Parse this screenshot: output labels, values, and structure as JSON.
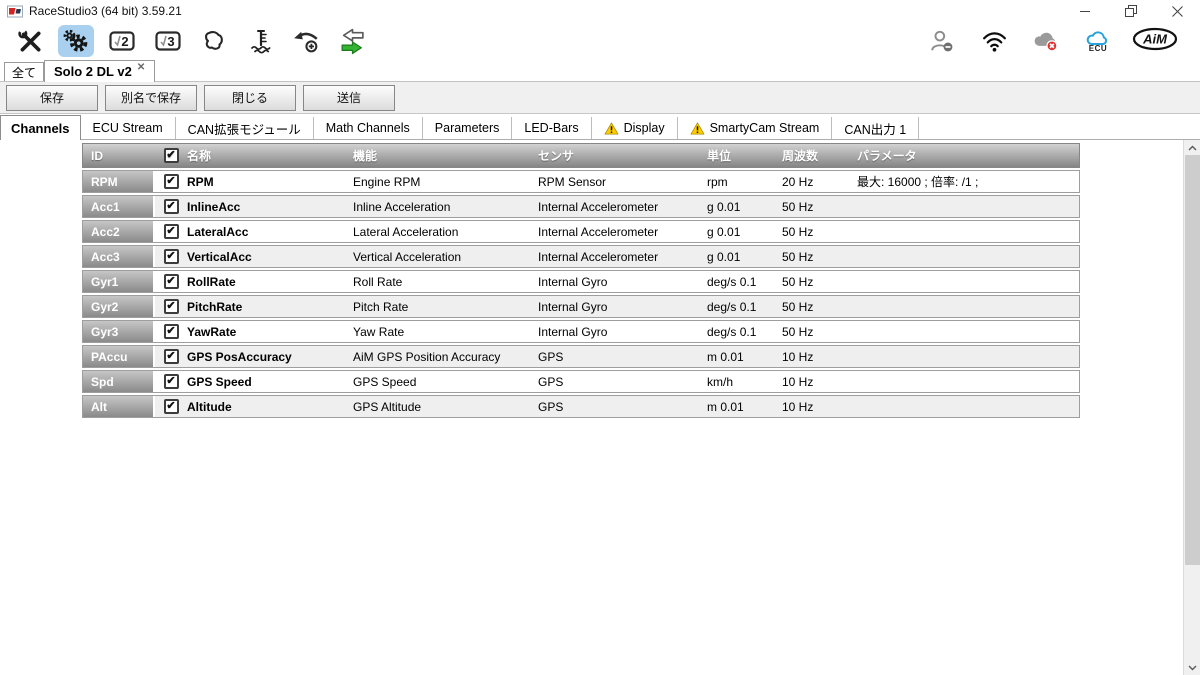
{
  "window": {
    "title": "RaceStudio3 (64 bit) 3.59.21"
  },
  "toolbar": {
    "left_icons": [
      {
        "name": "tools-wrench-icon",
        "active": false
      },
      {
        "name": "device-config-gear-icon",
        "active": true
      },
      {
        "name": "analysis-rs2-icon",
        "active": false,
        "glyph": "2"
      },
      {
        "name": "analysis-rs3-icon",
        "active": false,
        "glyph": "3"
      },
      {
        "name": "track-manager-icon",
        "active": false
      },
      {
        "name": "fuel-level-icon",
        "active": false
      },
      {
        "name": "add-device-icon",
        "active": false
      },
      {
        "name": "data-download-icon",
        "active": false
      }
    ],
    "right_icons": [
      {
        "name": "account-icon"
      },
      {
        "name": "wifi-icon"
      },
      {
        "name": "cloud-offline-icon"
      },
      {
        "name": "cloud-ecu-icon",
        "label": "ECU"
      },
      {
        "name": "aim-logo",
        "label": "AiM"
      }
    ]
  },
  "config_tabs": [
    {
      "label": "全て",
      "active": false,
      "closable": false
    },
    {
      "label": "Solo 2 DL v2",
      "active": true,
      "closable": true
    }
  ],
  "action_buttons": [
    {
      "label": "保存"
    },
    {
      "label": "別名で保存"
    },
    {
      "label": "閉じる"
    },
    {
      "label": "送信"
    }
  ],
  "device_tabs": [
    {
      "label": "Channels",
      "active": true,
      "warning": false
    },
    {
      "label": "ECU Stream",
      "active": false,
      "warning": false
    },
    {
      "label": "CAN拡張モジュール",
      "active": false,
      "warning": false
    },
    {
      "label": "Math Channels",
      "active": false,
      "warning": false
    },
    {
      "label": "Parameters",
      "active": false,
      "warning": false
    },
    {
      "label": "LED-Bars",
      "active": false,
      "warning": false
    },
    {
      "label": "Display",
      "active": false,
      "warning": true
    },
    {
      "label": "SmartyCam Stream",
      "active": false,
      "warning": true
    },
    {
      "label": "CAN出力 1",
      "active": false,
      "warning": false
    }
  ],
  "channels_table": {
    "headers": {
      "id": "ID",
      "name": "名称",
      "function": "機能",
      "sensor": "センサ",
      "unit": "単位",
      "frequency": "周波数",
      "parameters": "パラメータ"
    },
    "header_checkbox_checked": true,
    "rows": [
      {
        "id": "RPM",
        "checked": true,
        "name": "RPM",
        "function": "Engine RPM",
        "sensor": "RPM Sensor",
        "unit": "rpm",
        "frequency": "20 Hz",
        "parameters": "最大: 16000 ; 倍率: /1 ;"
      },
      {
        "id": "Acc1",
        "checked": true,
        "name": "InlineAcc",
        "function": "Inline Acceleration",
        "sensor": "Internal Accelerometer",
        "unit": "g 0.01",
        "frequency": "50 Hz",
        "parameters": ""
      },
      {
        "id": "Acc2",
        "checked": true,
        "name": "LateralAcc",
        "function": "Lateral Acceleration",
        "sensor": "Internal Accelerometer",
        "unit": "g 0.01",
        "frequency": "50 Hz",
        "parameters": ""
      },
      {
        "id": "Acc3",
        "checked": true,
        "name": "VerticalAcc",
        "function": "Vertical Acceleration",
        "sensor": "Internal Accelerometer",
        "unit": "g 0.01",
        "frequency": "50 Hz",
        "parameters": ""
      },
      {
        "id": "Gyr1",
        "checked": true,
        "name": "RollRate",
        "function": "Roll Rate",
        "sensor": "Internal Gyro",
        "unit": "deg/s 0.1",
        "frequency": "50 Hz",
        "parameters": ""
      },
      {
        "id": "Gyr2",
        "checked": true,
        "name": "PitchRate",
        "function": "Pitch Rate",
        "sensor": "Internal Gyro",
        "unit": "deg/s 0.1",
        "frequency": "50 Hz",
        "parameters": ""
      },
      {
        "id": "Gyr3",
        "checked": true,
        "name": "YawRate",
        "function": "Yaw Rate",
        "sensor": "Internal Gyro",
        "unit": "deg/s 0.1",
        "frequency": "50 Hz",
        "parameters": ""
      },
      {
        "id": "PAccu",
        "checked": true,
        "name": "GPS PosAccuracy",
        "function": "AiM GPS Position Accuracy",
        "sensor": "GPS",
        "unit": "m 0.01",
        "frequency": "10 Hz",
        "parameters": ""
      },
      {
        "id": "Spd",
        "checked": true,
        "name": "GPS Speed",
        "function": "GPS Speed",
        "sensor": "GPS",
        "unit": "km/h",
        "frequency": "10 Hz",
        "parameters": ""
      },
      {
        "id": "Alt",
        "checked": true,
        "name": "Altitude",
        "function": "GPS Altitude",
        "sensor": "GPS",
        "unit": "m 0.01",
        "frequency": "10 Hz",
        "parameters": ""
      }
    ]
  },
  "colors": {
    "accent_highlight": "#a9d1ef",
    "warning_yellow": "#ffcc00",
    "transfer_green": "#33b533",
    "cloud_blue": "#29a3dc",
    "error_red": "#e03030",
    "header_gradient_top": "#d2d2d2",
    "header_gradient_bottom": "#858585"
  }
}
